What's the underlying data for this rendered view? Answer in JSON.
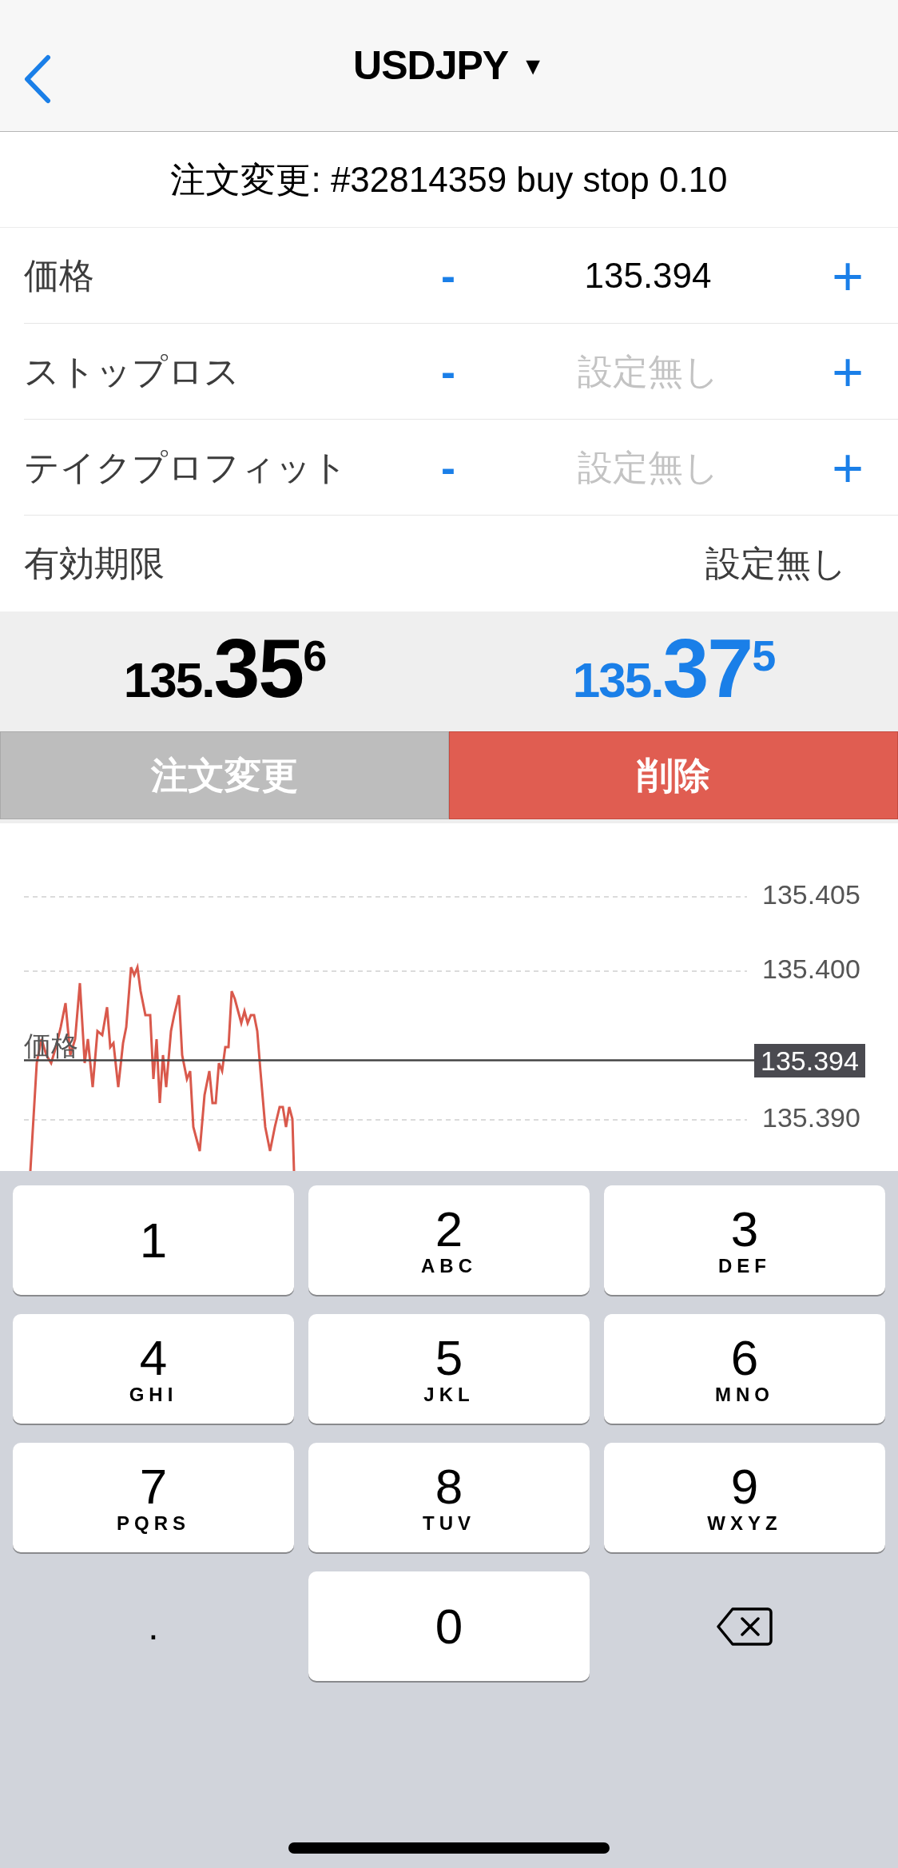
{
  "header": {
    "title": "USDJPY",
    "dropdown": "▼"
  },
  "order_title": "注文変更: #32814359 buy stop 0.10",
  "fields": [
    {
      "kind": "stepper",
      "label": "価格",
      "minus": "-",
      "value": "135.394",
      "set": true,
      "plus": "+"
    },
    {
      "kind": "stepper",
      "label": "ストップロス",
      "minus": "-",
      "value": "設定無し",
      "set": false,
      "plus": "+"
    },
    {
      "kind": "stepper",
      "label": "テイクプロフィット",
      "minus": "-",
      "value": "設定無し",
      "set": false,
      "plus": "+"
    },
    {
      "kind": "plain",
      "label": "有効期限",
      "value": "設定無し",
      "set": true
    }
  ],
  "quotes": [
    {
      "prefix": "135.",
      "big": "35",
      "sup": "6",
      "color": "#000000"
    },
    {
      "prefix": "135.",
      "big": "37",
      "sup": "5",
      "color": "#1a7fe8"
    }
  ],
  "buttons": [
    {
      "label": "注文変更",
      "kind": "modify"
    },
    {
      "label": "削除",
      "kind": "delete"
    }
  ],
  "chart": {
    "ticks": [
      "135.405",
      "135.400",
      "135.390"
    ],
    "line_label": "価格",
    "current_price": "135.394"
  },
  "keypad": [
    {
      "kind": "key",
      "digit": "1"
    },
    {
      "kind": "key",
      "digit": "2",
      "letters": "ABC"
    },
    {
      "kind": "key",
      "digit": "3",
      "letters": "DEF"
    },
    {
      "kind": "key",
      "digit": "4",
      "letters": "GHI"
    },
    {
      "kind": "key",
      "digit": "5",
      "letters": "JKL"
    },
    {
      "kind": "key",
      "digit": "6",
      "letters": "MNO"
    },
    {
      "kind": "key",
      "digit": "7",
      "letters": "PQRS"
    },
    {
      "kind": "key",
      "digit": "8",
      "letters": "TUV"
    },
    {
      "kind": "key",
      "digit": "9",
      "letters": "WXYZ"
    },
    {
      "kind": "plain",
      "digit": "."
    },
    {
      "kind": "key",
      "digit": "0"
    },
    {
      "kind": "delete"
    }
  ]
}
